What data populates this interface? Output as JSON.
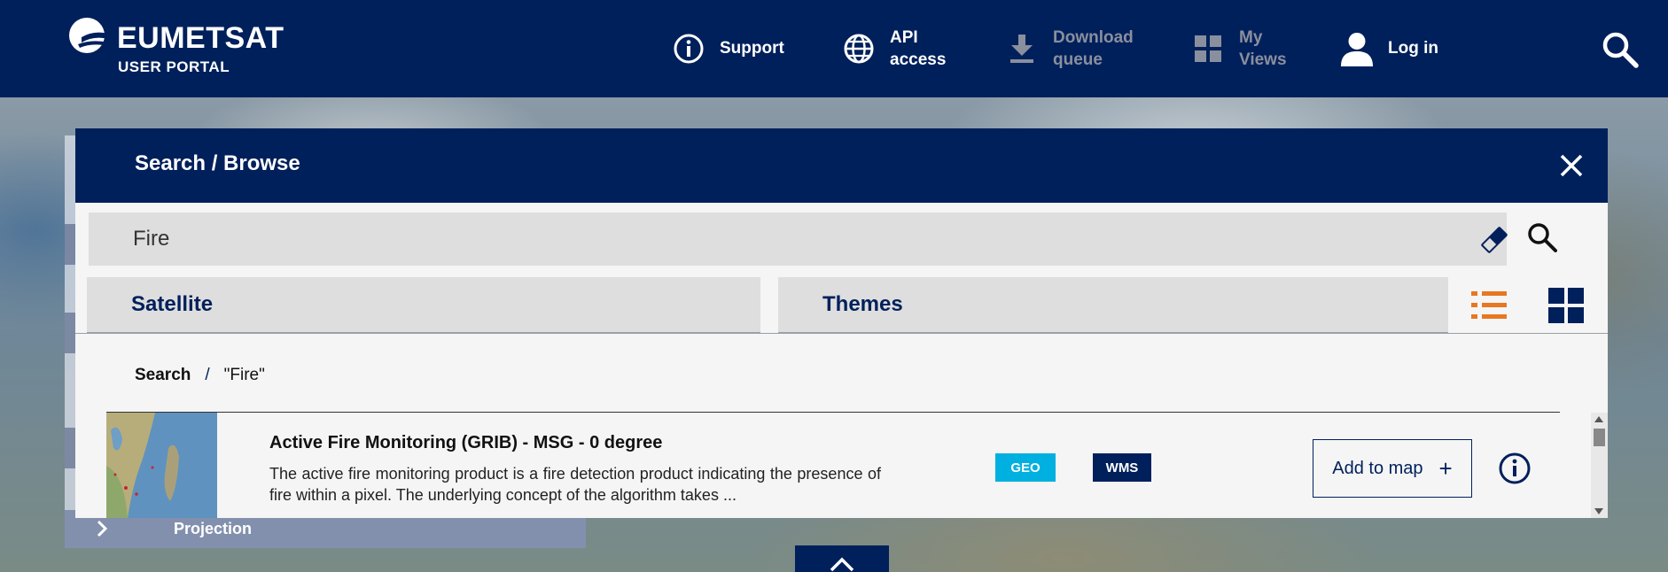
{
  "header": {
    "logo_name": "EUMETSAT",
    "logo_sub": "USER PORTAL",
    "nav": {
      "support": "Support",
      "api_line1": "API",
      "api_line2": "access",
      "download_line1": "Download",
      "download_line2": "queue",
      "views_line1": "My",
      "views_line2": "Views",
      "login": "Log in"
    }
  },
  "dialog": {
    "title": "Search / Browse",
    "search_value": "Fire",
    "tabs": {
      "satellite": "Satellite",
      "themes": "Themes"
    },
    "breadcrumb": {
      "root": "Search",
      "separator": "/",
      "query": "\"Fire\""
    }
  },
  "result": {
    "title": "Active Fire Monitoring (GRIB) - MSG - 0 degree",
    "description": "The active fire monitoring product is a fire detection product indicating the presence of fire within a pixel. The underlying concept of the algorithm takes ...",
    "badges": [
      "GEO",
      "WMS"
    ],
    "add_to_map": "Add to map",
    "add_symbol": "+"
  },
  "side_panel": {
    "projection": "Projection"
  },
  "colors": {
    "brand_navy": "#00205b",
    "geo_badge": "#00b0e0",
    "view_icon_active": "#e87722",
    "disabled_nav": "#8a8f9e"
  },
  "icons": {
    "support": "info-circle-icon",
    "api": "globe-icon",
    "download": "download-icon",
    "views": "grid-icon",
    "login": "user-icon",
    "search": "search-icon",
    "close": "close-icon",
    "eraser": "eraser-icon",
    "list_view": "list-view-icon",
    "grid_view": "grid-view-icon",
    "info": "info-icon",
    "chevron": "chevron-right-icon"
  }
}
